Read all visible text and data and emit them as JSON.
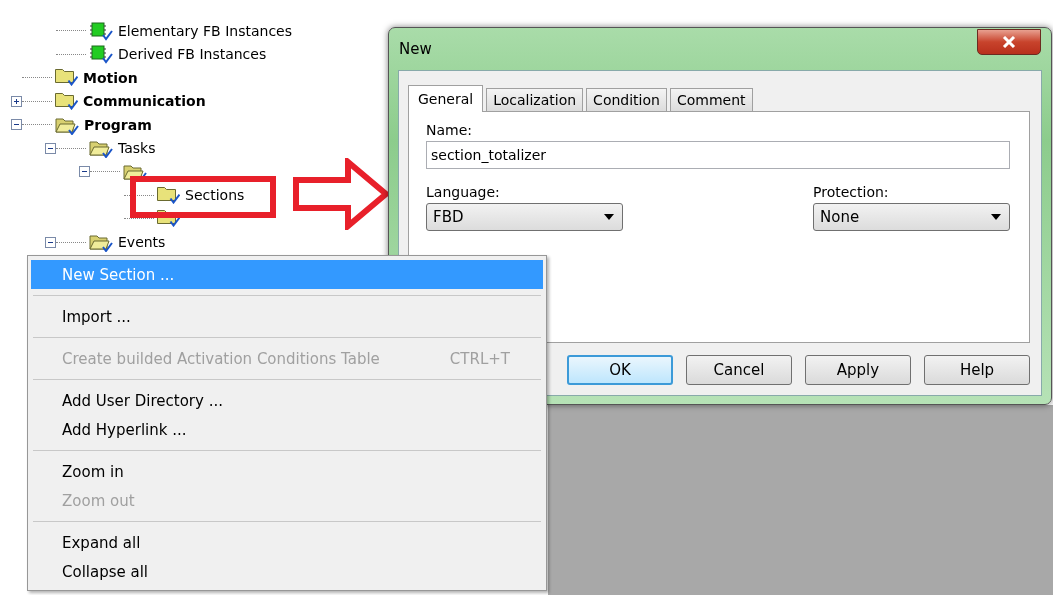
{
  "tree": [
    {
      "kind": "offscreen",
      "children": [
        {
          "kind": "fb",
          "label": "Elementary FB Instances"
        },
        {
          "kind": "fb",
          "label": "Derived FB Instances"
        }
      ]
    },
    {
      "kind": "folder",
      "label": "Motion",
      "bold": true
    },
    {
      "kind": "folder",
      "label": "Communication",
      "bold": true,
      "expanded": false
    },
    {
      "kind": "folder-open",
      "label": "Program",
      "bold": true,
      "expanded": true,
      "children": [
        {
          "kind": "folder-open",
          "label": "Tasks",
          "expanded": true,
          "children": [
            {
              "kind": "folder-open",
              "expanded": true,
              "children": [
                {
                  "kind": "folder",
                  "label": "Sections"
                },
                {
                  "kind": "folder"
                }
              ]
            }
          ]
        },
        {
          "kind": "folder-open",
          "label": "Events",
          "expanded": true
        }
      ]
    }
  ],
  "context_menu": [
    {
      "kind": "item",
      "label": "New Section ...",
      "selected": true,
      "disabled": false
    },
    {
      "kind": "separator"
    },
    {
      "kind": "item",
      "label": "Import ...",
      "selected": false,
      "disabled": false
    },
    {
      "kind": "separator"
    },
    {
      "kind": "item",
      "label": "Create builded Activation Conditions Table",
      "shortcut": "CTRL+T",
      "selected": false,
      "disabled": true
    },
    {
      "kind": "separator"
    },
    {
      "kind": "item",
      "label": "Add User Directory ...",
      "selected": false,
      "disabled": false
    },
    {
      "kind": "item",
      "label": "Add Hyperlink ...",
      "selected": false,
      "disabled": false
    },
    {
      "kind": "separator"
    },
    {
      "kind": "item",
      "label": "Zoom in",
      "selected": false,
      "disabled": false
    },
    {
      "kind": "item",
      "label": "Zoom out",
      "selected": false,
      "disabled": true
    },
    {
      "kind": "separator"
    },
    {
      "kind": "item",
      "label": "Expand all",
      "selected": false,
      "disabled": false
    },
    {
      "kind": "item",
      "label": "Collapse all",
      "selected": false,
      "disabled": false
    }
  ],
  "dialog": {
    "title": "New",
    "tabs": [
      {
        "label": "General",
        "selected": true
      },
      {
        "label": "Localization",
        "selected": false
      },
      {
        "label": "Condition",
        "selected": false
      },
      {
        "label": "Comment",
        "selected": false
      }
    ],
    "name": {
      "label": "Name:",
      "value": "section_totalizer"
    },
    "language": {
      "label": "Language:",
      "value": "FBD"
    },
    "protection": {
      "label": "Protection:",
      "value": "None"
    },
    "buttons": [
      {
        "label": "OK",
        "default": true
      },
      {
        "label": "Cancel",
        "default": false
      },
      {
        "label": "Apply",
        "default": false
      },
      {
        "label": "Help",
        "default": false
      }
    ]
  }
}
